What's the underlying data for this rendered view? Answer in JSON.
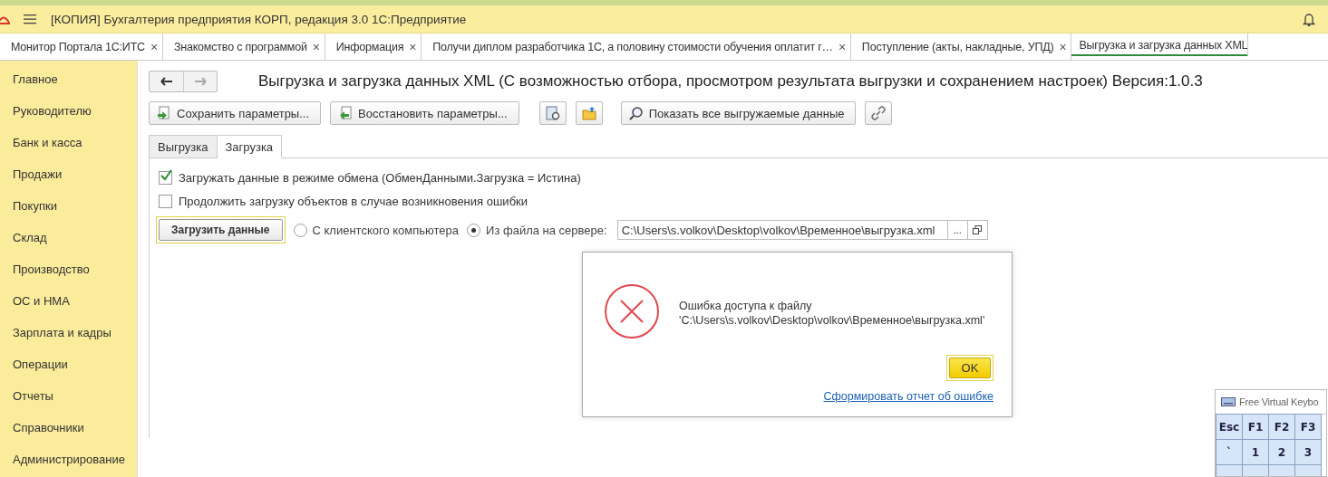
{
  "window": {
    "title": "[КОПИЯ] Бухгалтерия предприятия КОРП, редакция 3.0 1С:Предприятие"
  },
  "tabs": [
    {
      "label": "Монитор Портала 1С:ИТС",
      "close": "×",
      "selected": false
    },
    {
      "label": "Знакомство с программой",
      "close": "×",
      "selected": false
    },
    {
      "label": "Информация",
      "close": "×",
      "selected": false
    },
    {
      "label": "Получи диплом разработчика 1С, а половину стоимости обучения оплатит г…",
      "close": "×",
      "selected": false
    },
    {
      "label": "Поступление (акты, накладные, УПД)",
      "close": "×",
      "selected": false
    },
    {
      "label": "Выгрузка и загрузка данных XML",
      "selected": true
    }
  ],
  "sidebar": {
    "items": [
      "Главное",
      "Руководителю",
      "Банк и касса",
      "Продажи",
      "Покупки",
      "Склад",
      "Производство",
      "ОС и НМА",
      "Зарплата и кадры",
      "Операции",
      "Отчеты",
      "Справочники",
      "Администрирование"
    ]
  },
  "form": {
    "title": "Выгрузка и загрузка данных XML (С возможностью отбора, просмотром результата выгрузки и сохранением настроек) Версия:1.0.3",
    "toolbar": [
      {
        "kind": "save",
        "label": "Сохранить параметры..."
      },
      {
        "kind": "restore",
        "label": "Восстановить параметры..."
      },
      {
        "kind": "settings"
      },
      {
        "kind": "folder"
      },
      {
        "kind": "search",
        "label": "Показать все выгружаемые данные"
      },
      {
        "kind": "link"
      }
    ],
    "tabs": [
      {
        "label": "Выгрузка",
        "selected": false
      },
      {
        "label": "Загрузка",
        "selected": true
      }
    ],
    "checkboxes": [
      {
        "label": "Загружать данные в режиме обмена (ОбменДанными.Загрузка = Истина)",
        "checked": true
      },
      {
        "label": "Продолжить загрузку объектов в случае возникновения ошибки",
        "checked": false
      }
    ],
    "load_button": "Загрузить данные",
    "sources": [
      {
        "label": "С клиентского компьютера",
        "selected": false
      },
      {
        "label": "Из файла на сервере:",
        "selected": true
      }
    ],
    "path": {
      "value": "C:\\Users\\s.volkov\\Desktop\\volkov\\Временное\\выгрузка.xml",
      "choose": "..."
    }
  },
  "dialog": {
    "message": [
      "Ошибка доступа к файлу",
      "'C:\\Users\\s.volkov\\Desktop\\volkov\\Временное\\выгрузка.xml'"
    ],
    "ok": "OK",
    "report_link": "Сформировать отчет об ошибке"
  },
  "keyboard": {
    "title": "Free Virtual Keybo",
    "rows": [
      [
        "Esc",
        "F1",
        "F2",
        "F3"
      ],
      [
        "`",
        "1",
        "2",
        "3"
      ]
    ]
  }
}
